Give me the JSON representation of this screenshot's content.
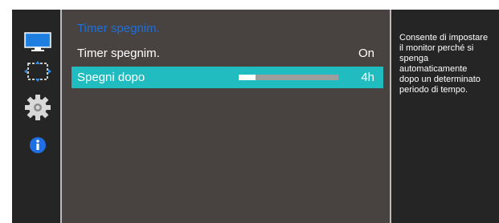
{
  "sidebar": {
    "items": [
      {
        "icon": "monitor-icon"
      },
      {
        "icon": "screen-size-icon"
      },
      {
        "icon": "gear-icon"
      },
      {
        "icon": "info-icon"
      }
    ]
  },
  "main": {
    "title": "Timer spegnim.",
    "rows": [
      {
        "label": "Timer spegnim.",
        "value": "On"
      },
      {
        "label": "Spegni dopo",
        "value": "4h",
        "level": 0.17
      }
    ]
  },
  "help": {
    "lines": [
      "Consente di impostare",
      "il monitor perché si",
      "spenga",
      "automaticamente",
      "dopo un determinato",
      "periodo di tempo."
    ]
  },
  "colors": {
    "accent": "#21bcc0",
    "title": "#1f6fd6",
    "panel": "#484341",
    "sidebar": "#252525"
  }
}
